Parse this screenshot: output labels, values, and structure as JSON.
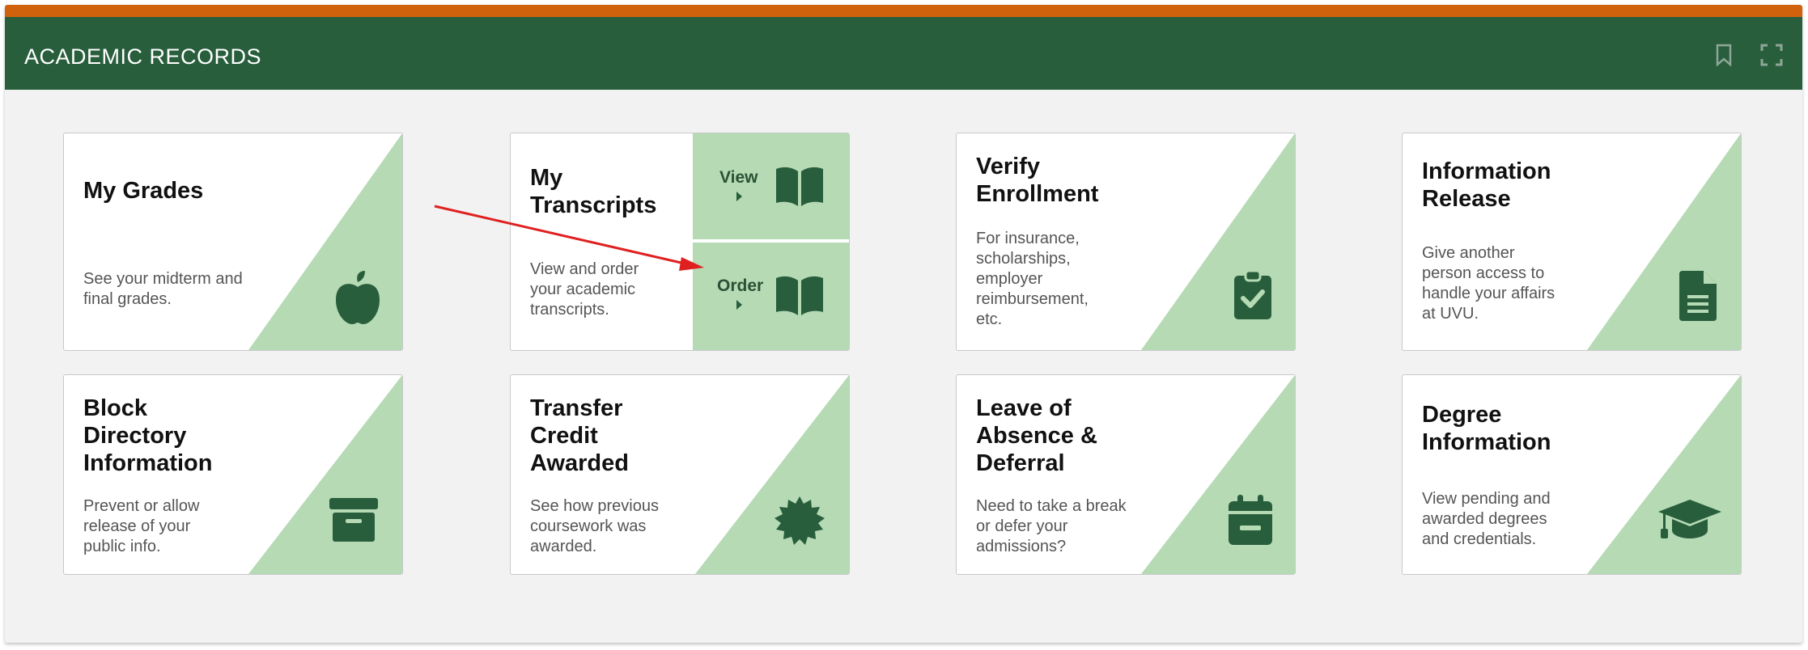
{
  "header": {
    "title": "ACADEMIC RECORDS",
    "bookmark_icon": "bookmark-icon",
    "expand_icon": "expand-icon"
  },
  "colors": {
    "stripe": "#d1620d",
    "header_bg": "#285e3c",
    "tile_green": "#b5dab4",
    "icon_green": "#285e3c",
    "arrow": "#e02020"
  },
  "tiles": {
    "my_grades": {
      "title": "My Grades",
      "desc": "See your midterm and final grades.",
      "icon": "apple-icon"
    },
    "my_transcripts": {
      "title_line1": "My",
      "title_line2": "Transcripts",
      "desc": "View and order your academic transcripts.",
      "view_label": "View",
      "order_label": "Order",
      "icon": "book-icon"
    },
    "verify_enrollment": {
      "title_line1": "Verify",
      "title_line2": "Enrollment",
      "desc": "For insurance, scholarships, employer reimbursement, etc.",
      "icon": "clipboard-check-icon"
    },
    "information_release": {
      "title_line1": "Information",
      "title_line2": "Release",
      "desc": "Give another person access to handle your affairs at UVU.",
      "icon": "document-icon"
    },
    "block_directory": {
      "title_line1": "Block",
      "title_line2": "Directory",
      "title_line3": "Information",
      "desc": "Prevent or allow release of your public info.",
      "icon": "archive-box-icon"
    },
    "transfer_credit": {
      "title_line1": "Transfer",
      "title_line2": "Credit",
      "title_line3": "Awarded",
      "desc": "See how previous coursework was awarded.",
      "icon": "certificate-icon"
    },
    "leave_of_absence": {
      "title_line1": "Leave of",
      "title_line2": "Absence &",
      "title_line3": "Deferral",
      "desc": "Need to take a break or defer your admissions?",
      "icon": "calendar-minus-icon"
    },
    "degree_information": {
      "title_line1": "Degree",
      "title_line2": "Information",
      "desc": "View pending and awarded degrees and credentials.",
      "icon": "graduation-cap-icon"
    }
  }
}
